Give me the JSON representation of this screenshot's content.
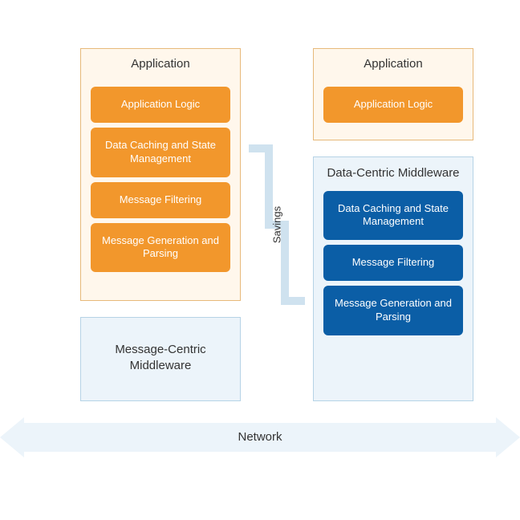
{
  "left": {
    "appTitle": "Application",
    "appBoxes": [
      "Application Logic",
      "Data Caching and State Management",
      "Message Filtering",
      "Message Generation and Parsing"
    ],
    "mwTitle": "Message-Centric Middleware"
  },
  "right": {
    "appTitle": "Application",
    "appBoxes": [
      "Application Logic"
    ],
    "mwTitle": "Data-Centric Middleware",
    "mwBoxes": [
      "Data Caching and State Management",
      "Message Filtering",
      "Message Generation and Parsing"
    ]
  },
  "savingsLabel": "Savings",
  "networkLabel": "Network"
}
